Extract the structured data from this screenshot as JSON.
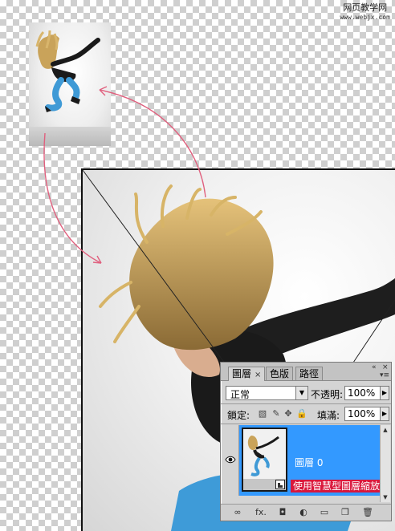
{
  "watermark": {
    "line1": "网页教学网",
    "line2": "www.webjx.com"
  },
  "layers_panel": {
    "tabs": [
      {
        "label": "圖層",
        "active": true
      },
      {
        "label": "色版",
        "active": false
      },
      {
        "label": "路徑",
        "active": false
      }
    ],
    "tab_close": "×",
    "collapse_glyph": "«",
    "close_glyph": "×",
    "menu_glyph": "▾≡",
    "blend_mode": "正常",
    "opacity_label": "不透明:",
    "opacity_value": "100%",
    "lock_label": "鎖定:",
    "fill_label": "填滿:",
    "fill_value": "100%",
    "lock_icons": [
      "transparency-lock-icon",
      "brush-lock-icon",
      "move-lock-icon",
      "padlock-icon"
    ],
    "layer": {
      "name": "圖層 0",
      "visible": true,
      "selected": true,
      "smart_object": true
    },
    "smart_tooltip": "使用智慧型圖層縮放",
    "footer_icons": [
      "link-icon",
      "fx-icon",
      "mask-icon",
      "adjustment-icon",
      "folder-icon",
      "new-layer-icon",
      "trash-icon"
    ],
    "footer_glyphs": {
      "link": "∞",
      "fx": "fx.",
      "mask": "◘",
      "adjust": "◐",
      "folder": "▭",
      "new_layer": "❐",
      "trash": "🗑"
    }
  },
  "colors": {
    "selection": "#3399ff",
    "tooltip_bg": "#d9173c",
    "arrow": "#e0607e",
    "transparency_check": "#cfcfcf"
  }
}
